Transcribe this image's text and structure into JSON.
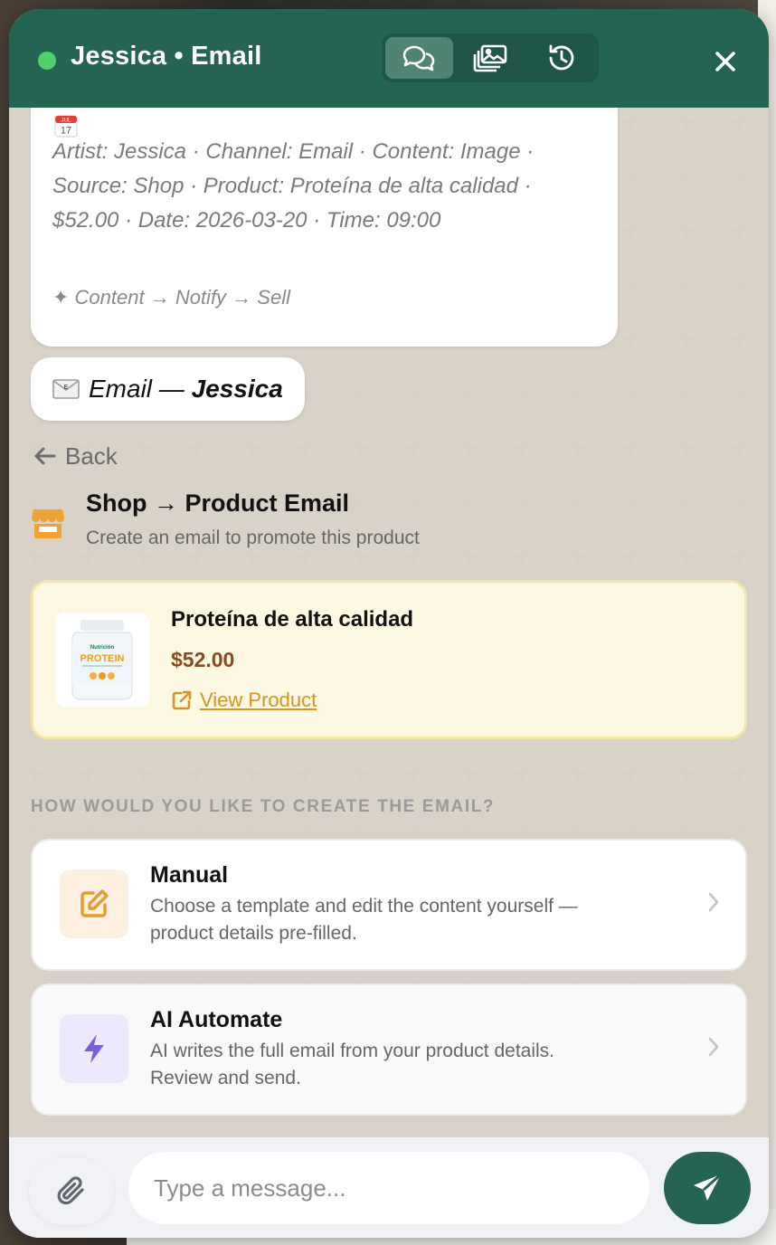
{
  "header": {
    "title": "Jessica • Email",
    "status_color": "#4fcf6a",
    "tabs": [
      {
        "icon": "chat-bubbles-icon",
        "active": true
      },
      {
        "icon": "media-gallery-icon",
        "active": false
      },
      {
        "icon": "history-icon",
        "active": false
      }
    ],
    "close_icon": "close-icon"
  },
  "info_bubble": {
    "icon": "calendar-icon",
    "calendar_label": "JUL",
    "calendar_day": "17",
    "meta_line1": "Artist: Jessica  ·  Channel: Email  ·  Content: Image  ·",
    "meta_line2": "Source: Shop  ·  Product: Proteína de alta calidad ·",
    "meta_line3": "$52.00  ·  Date: 2026-03-20  ·  Time: 09:00",
    "flow": "✦ Content → Notify → Sell"
  },
  "email_bubble": {
    "icon": "envelope-icon",
    "prefix": "Email — ",
    "artist": "Jessica"
  },
  "back_label": "Back",
  "section": {
    "icon": "shop-icon",
    "title": "Shop → Product Email",
    "subtitle": "Create an email to promote this product"
  },
  "product": {
    "name": "Proteína de alta calidad",
    "price": "$52.00",
    "link_label": "View Product",
    "image_brand": "Nutrición",
    "image_label": "PROTEIN"
  },
  "question": "HOW WOULD YOU LIKE TO CREATE THE EMAIL?",
  "options": [
    {
      "title": "Manual",
      "desc_line1": "Choose a template and edit the content yourself —",
      "desc_line2": "product details pre-filled.",
      "icon": "edit-icon"
    },
    {
      "title": "AI Automate",
      "desc_line1": "AI writes the full email from your product details.",
      "desc_line2": "Review and send.",
      "icon": "lightning-icon"
    }
  ],
  "composer": {
    "placeholder": "Type a message...",
    "attach_icon": "paperclip-icon",
    "send_icon": "send-icon"
  },
  "colors": {
    "header_bg": "#256352",
    "accent_orange": "#d99224",
    "price_brown": "#8a4a1e",
    "ai_purple": "#7c5ce0"
  }
}
